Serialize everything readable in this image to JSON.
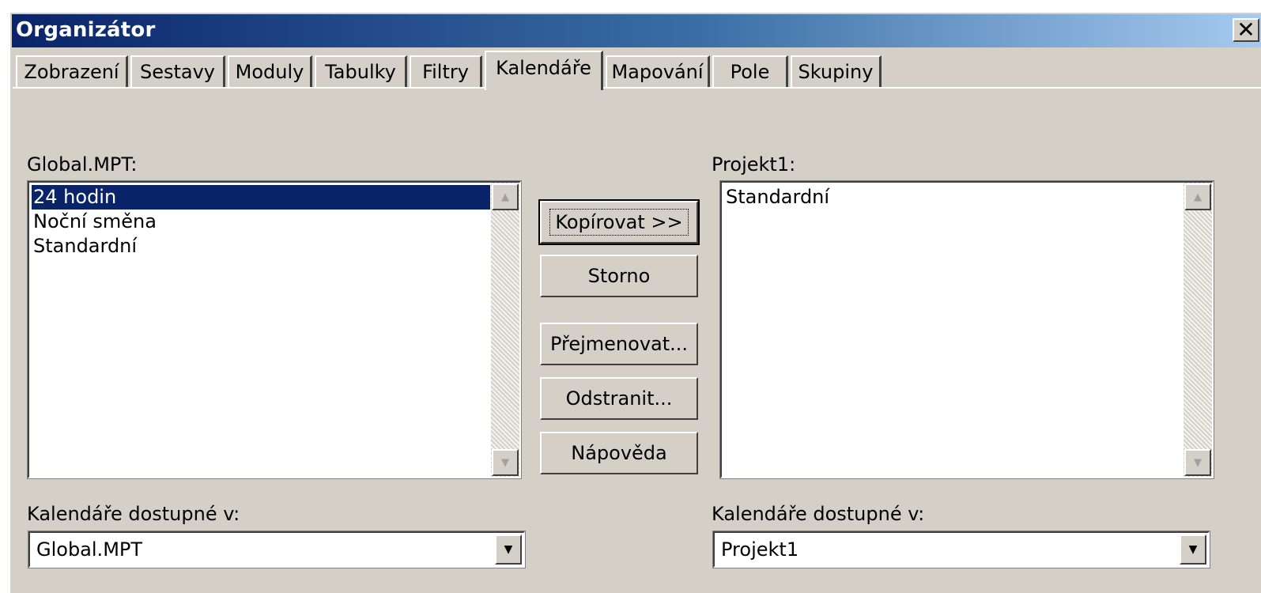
{
  "window": {
    "title": "Organizátor",
    "close_glyph": "✕"
  },
  "tabs": [
    {
      "label": "Zobrazení",
      "active": false
    },
    {
      "label": "Sestavy",
      "active": false
    },
    {
      "label": "Moduly",
      "active": false
    },
    {
      "label": "Tabulky",
      "active": false
    },
    {
      "label": "Filtry",
      "active": false
    },
    {
      "label": "Kalendáře",
      "active": true
    },
    {
      "label": "Mapování",
      "active": false
    },
    {
      "label": "Pole",
      "active": false
    },
    {
      "label": "Skupiny",
      "active": false
    }
  ],
  "left": {
    "label": "Global.MPT:",
    "items": [
      "24 hodin",
      "Noční směna",
      "Standardní"
    ],
    "selected_index": 0,
    "available_label": "Kalendáře dostupné v:",
    "available_value": "Global.MPT"
  },
  "right": {
    "label": "Projekt1:",
    "items": [
      "Standardní"
    ],
    "available_label": "Kalendáře dostupné v:",
    "available_value": "Projekt1"
  },
  "buttons": {
    "copy": "Kopírovat >>",
    "cancel": "Storno",
    "rename": "Přejmenovat...",
    "delete": "Odstranit...",
    "help": "Nápověda"
  },
  "icons": {
    "scroll_up": "▲",
    "scroll_down": "▼",
    "dropdown": "▼"
  },
  "colors": {
    "selection": "#0a246a",
    "dialog_face": "#d4d0c8"
  }
}
